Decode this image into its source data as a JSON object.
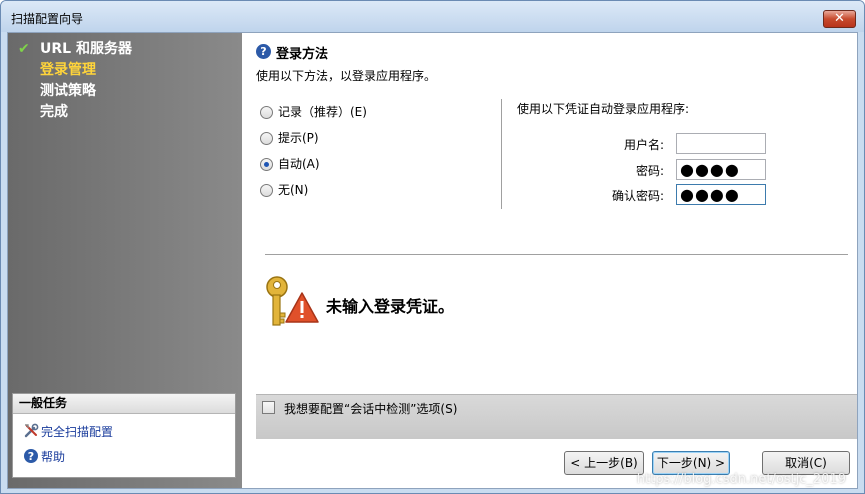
{
  "window": {
    "title": "扫描配置向导",
    "close_glyph": "✕"
  },
  "sidebar": {
    "steps": [
      {
        "label": "URL 和服务器",
        "state": "done"
      },
      {
        "label": "登录管理",
        "state": "current"
      },
      {
        "label": "测试策略",
        "state": "pending"
      },
      {
        "label": "完成",
        "state": "pending"
      }
    ],
    "tasks": {
      "header": "一般任务",
      "items": [
        {
          "label": "完全扫描配置",
          "icon": "tools-icon"
        },
        {
          "label": "帮助",
          "icon": "help-icon"
        }
      ]
    }
  },
  "main": {
    "section_title": "登录方法",
    "section_desc": "使用以下方法，以登录应用程序。",
    "methods": [
      {
        "label": "记录（推荐）(E)",
        "checked": false
      },
      {
        "label": "提示(P)",
        "checked": false
      },
      {
        "label": "自动(A)",
        "checked": true
      },
      {
        "label": "无(N)",
        "checked": false
      }
    ],
    "credentials": {
      "title": "使用以下凭证自动登录应用程序:",
      "username_label": "用户名:",
      "username_value": "",
      "password_label": "密码:",
      "password_value": "●●●●",
      "confirm_label": "确认密码:",
      "confirm_value": "●●●●"
    },
    "warning_text": "未输入登录凭证。",
    "options_checkbox_label": "我想要配置“会话中检测”选项(S)",
    "options_checked": false
  },
  "buttons": {
    "back": "< 上一步(B)",
    "next": "下一步(N) >",
    "cancel": "取消(C)"
  },
  "watermark": "https://blog.csdn.net/ostjc_2019",
  "colors": {
    "current_step": "#ffd43a",
    "done_check": "#7fd34a",
    "link": "#1a3c9c",
    "warning_triangle": "#e0502a"
  }
}
